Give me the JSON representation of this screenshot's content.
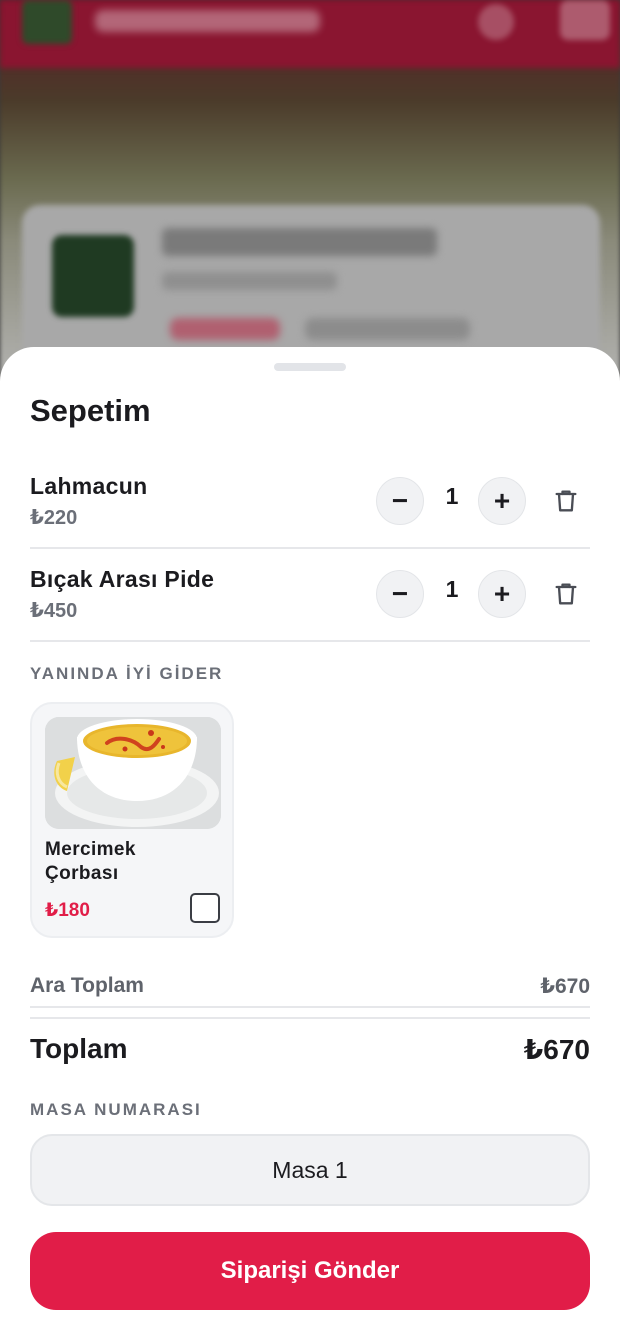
{
  "background": {
    "note_visible_text": ""
  },
  "cart": {
    "title": "Sepetim",
    "items": [
      {
        "name": "Lahmacun",
        "price": "₺220",
        "quantity": "1",
        "minus": "−",
        "plus": "+"
      },
      {
        "name": "Bıçak Arası Pide",
        "price": "₺450",
        "quantity": "1",
        "minus": "−",
        "plus": "+"
      }
    ]
  },
  "suggestions": {
    "label": "YANINDA İYİ GİDER",
    "items": [
      {
        "name": "Mercimek Çorbası",
        "price": "₺180",
        "checked": false
      }
    ]
  },
  "summary": {
    "subtotal_label": "Ara Toplam",
    "subtotal_value": "₺670",
    "total_label": "Toplam",
    "total_value": "₺670"
  },
  "table": {
    "label": "MASA NUMARASI",
    "value": "Masa 1"
  },
  "submit": {
    "label": "Siparişi Gönder"
  },
  "colors": {
    "accent": "#e11d48",
    "text": "#1b1b1f",
    "muted": "#6b6f78"
  }
}
